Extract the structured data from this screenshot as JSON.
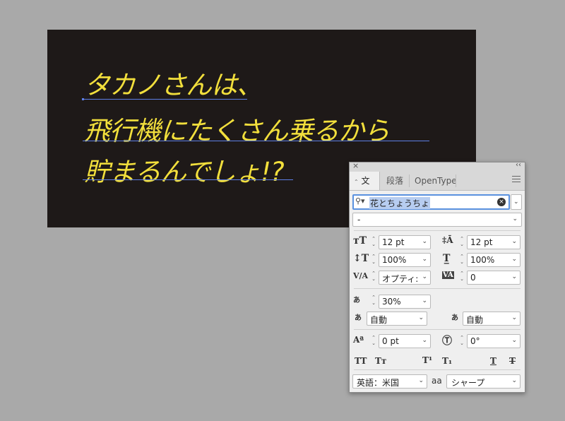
{
  "artboard": {
    "lines": [
      "タカノさんは、",
      "飛行機にたくさん乗るから",
      "貯まるんでしょ!?"
    ],
    "text_color": "#f2df3c",
    "background": "#1e1918",
    "baseline_color": "#5d7fe6"
  },
  "panel": {
    "close_glyph": "×",
    "collapse_glyph": "‹‹",
    "tabs": [
      "文字",
      "段落",
      "OpenType"
    ],
    "font_family": "花とちょうちょ",
    "font_style": "-",
    "font_size": "12 pt",
    "leading": "12 pt",
    "vertical_scale": "100%",
    "horizontal_scale": "100%",
    "kerning": "オプティ:",
    "tracking": "0",
    "tsume": "30%",
    "aki_left": "自動",
    "aki_right": "自動",
    "baseline_shift": "0 pt",
    "rotation": "0°",
    "language": "英語：米国",
    "antialias": "シャープ",
    "aa_label": "aa",
    "accent_color": "#5a91df"
  }
}
